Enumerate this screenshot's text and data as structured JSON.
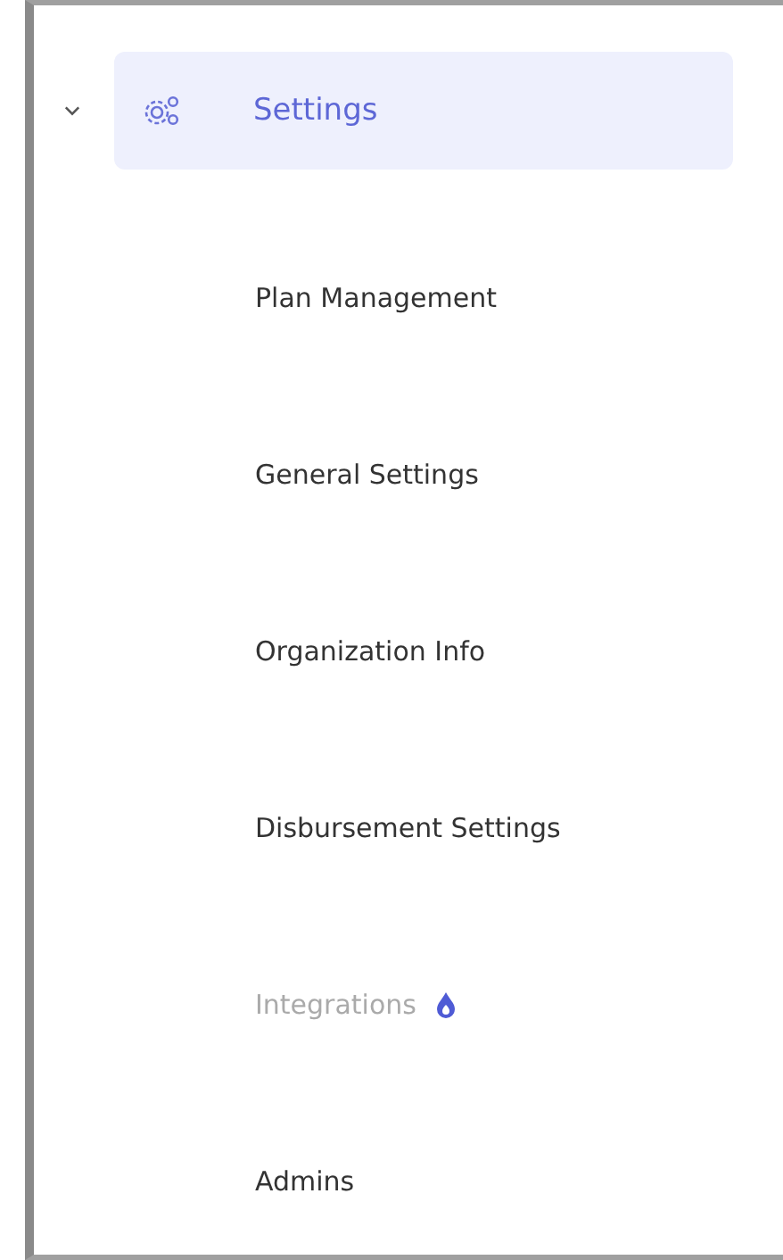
{
  "section": {
    "label": "Settings",
    "expanded": true,
    "selected": true
  },
  "items": [
    {
      "label": "Plan Management",
      "disabled": false,
      "flagged": false
    },
    {
      "label": "General Settings",
      "disabled": false,
      "flagged": false
    },
    {
      "label": "Organization Info",
      "disabled": false,
      "flagged": false
    },
    {
      "label": "Disbursement Settings",
      "disabled": false,
      "flagged": false
    },
    {
      "label": "Integrations",
      "disabled": true,
      "flagged": true
    },
    {
      "label": "Admins",
      "disabled": false,
      "flagged": false
    }
  ]
}
